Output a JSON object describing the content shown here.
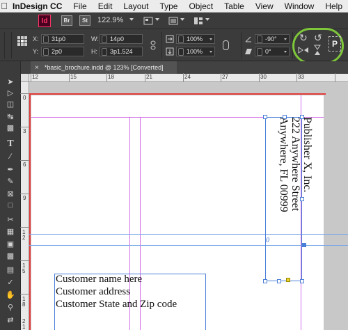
{
  "menubar": {
    "apple": "",
    "app_name": "InDesign CC",
    "items": [
      "File",
      "Edit",
      "Layout",
      "Type",
      "Object",
      "Table",
      "View",
      "Window",
      "Help"
    ]
  },
  "appbar": {
    "logo": "Id",
    "bridge": "Br",
    "stock": "St",
    "zoom": "122.9%"
  },
  "control": {
    "x_label": "X:",
    "x_value": "31p0",
    "y_label": "Y:",
    "y_value": "2p0",
    "w_label": "W:",
    "w_value": "14p0",
    "h_label": "H:",
    "h_value": "3p1.524",
    "scale_x": "100%",
    "scale_y": "100%",
    "rotation": "-90°",
    "shear": "0°",
    "rotate_cw_icon": "↻",
    "rotate_ccw_icon": "↺",
    "flip_h_icon": "⊳⊲",
    "flip_v_icon": "⧗",
    "p_indicator": "P"
  },
  "document": {
    "tab_title": "*basic_brochure.indd @ 123% [Converted]",
    "close": "×"
  },
  "rulers": {
    "h_labels": [
      "12",
      "15",
      "18",
      "21",
      "24",
      "27",
      "30",
      "33"
    ],
    "v_labels": [
      "0",
      "3",
      "6",
      "9",
      "1 2",
      "1 5",
      "1 8",
      "2 1"
    ]
  },
  "content": {
    "publisher_lines": [
      "Publisher X, Inc.",
      "222 Anywhere Street",
      "Anywhere, FL 00999"
    ],
    "customer_lines": [
      "Customer name here",
      "Customer address",
      "Customer State and Zip code"
    ],
    "overset_marker": "0"
  },
  "colors": {
    "accent_highlight": "#7ec63a",
    "frame_blue": "#4a7fd8",
    "margin_magenta": "#d36ee8",
    "bleed_red": "#e23a3a"
  }
}
